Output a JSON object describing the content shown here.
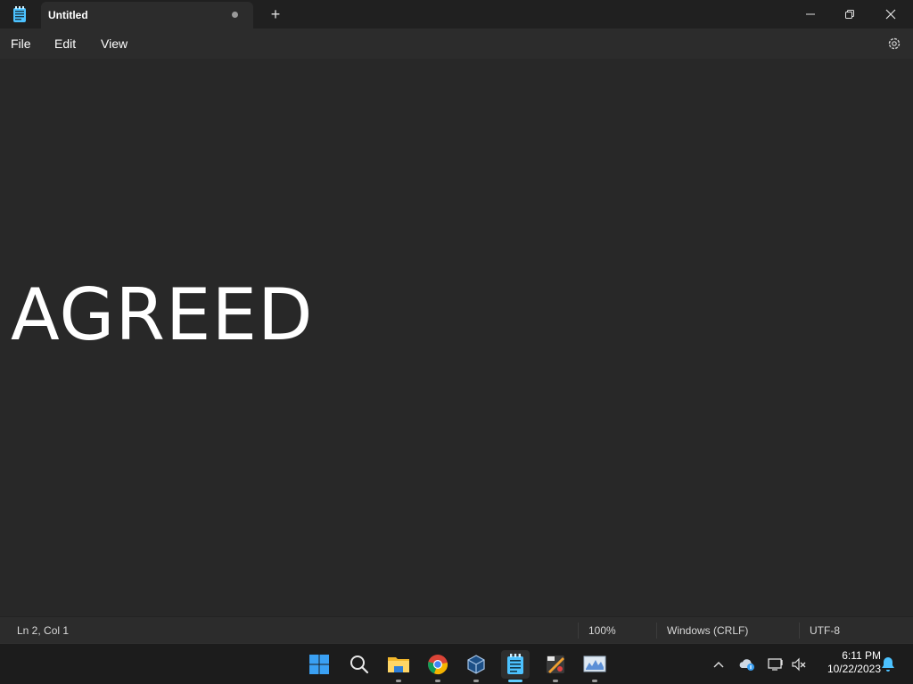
{
  "window": {
    "tab_title": "Untitled",
    "new_tab_label": "+"
  },
  "menu": {
    "file": "File",
    "edit": "Edit",
    "view": "View"
  },
  "editor": {
    "content": "AGREED"
  },
  "status": {
    "position": "Ln 2, Col 1",
    "zoom": "100%",
    "line_ending": "Windows (CRLF)",
    "encoding": "UTF-8"
  },
  "taskbar": {
    "apps": [
      "start-icon",
      "search-icon",
      "file-explorer-icon",
      "chrome-icon",
      "virtualbox-icon",
      "notepad-icon",
      "paint-tool-icon",
      "system-monitor-icon"
    ],
    "active_app": "notepad-icon"
  },
  "tray": {
    "time": "6:11 PM",
    "date": "10/22/2023"
  },
  "colors": {
    "accent": "#60cdff",
    "editor_bg": "#282828",
    "chrome_bg": "#2c2c2c"
  }
}
